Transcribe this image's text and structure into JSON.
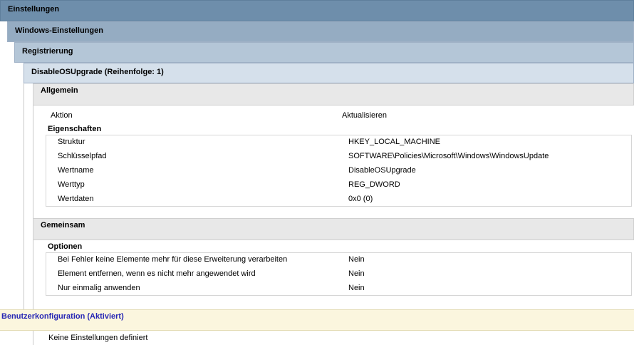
{
  "levels": {
    "settings": "Einstellungen",
    "windows_settings": "Windows-Einstellungen",
    "registry": "Registrierung",
    "item": "DisableOSUpgrade (Reihenfolge: 1)"
  },
  "general": {
    "title": "Allgemein",
    "action_label": "Aktion",
    "action_value": "Aktualisieren",
    "properties_title": "Eigenschaften",
    "properties": [
      {
        "label": "Struktur",
        "value": "HKEY_LOCAL_MACHINE"
      },
      {
        "label": "Schlüsselpfad",
        "value": "SOFTWARE\\Policies\\Microsoft\\Windows\\WindowsUpdate"
      },
      {
        "label": "Wertname",
        "value": "DisableOSUpgrade"
      },
      {
        "label": "Werttyp",
        "value": "REG_DWORD"
      },
      {
        "label": "Wertdaten",
        "value": "0x0 (0)"
      }
    ]
  },
  "common": {
    "title": "Gemeinsam",
    "options_title": "Optionen",
    "options": [
      {
        "label": "Bei Fehler keine Elemente mehr für diese Erweiterung verarbeiten",
        "value": "Nein"
      },
      {
        "label": "Element entfernen, wenn es nicht mehr angewendet wird",
        "value": "Nein"
      },
      {
        "label": "Nur einmalig anwenden",
        "value": "Nein"
      }
    ]
  },
  "user_config": {
    "title": "Benutzerkonfiguration (Aktiviert)",
    "empty_text": "Keine Einstellungen definiert"
  }
}
